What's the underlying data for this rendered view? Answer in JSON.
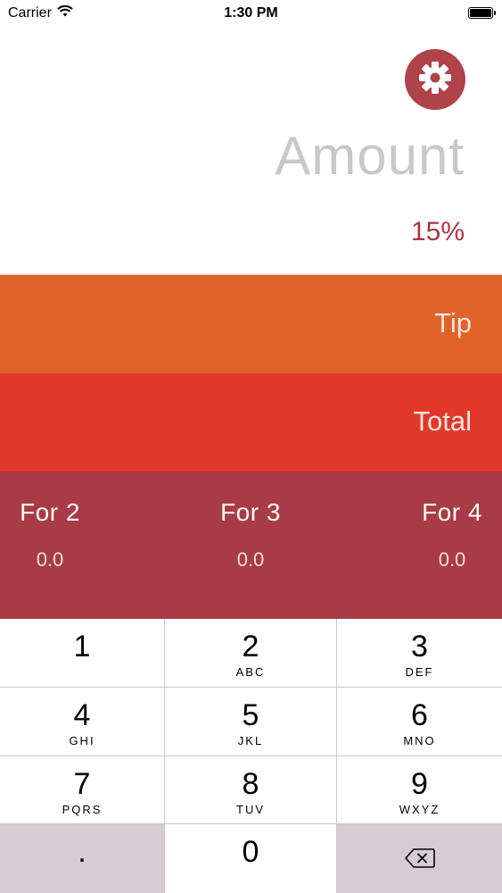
{
  "status_bar": {
    "carrier": "Carrier",
    "time": "1:30 PM",
    "battery_level": 1.0
  },
  "header": {
    "settings_icon": "gear-icon",
    "amount_placeholder": "Amount",
    "tip_percent": "15%"
  },
  "bands": {
    "tip_label": "Tip",
    "total_label": "Total"
  },
  "split": [
    {
      "label": "For 2",
      "value": "0.0"
    },
    {
      "label": "For 3",
      "value": "0.0"
    },
    {
      "label": "For 4",
      "value": "0.0"
    }
  ],
  "keypad": {
    "keys": [
      {
        "num": "1",
        "letters": ""
      },
      {
        "num": "2",
        "letters": "ABC"
      },
      {
        "num": "3",
        "letters": "DEF"
      },
      {
        "num": "4",
        "letters": "GHI"
      },
      {
        "num": "5",
        "letters": "JKL"
      },
      {
        "num": "6",
        "letters": "MNO"
      },
      {
        "num": "7",
        "letters": "PQRS"
      },
      {
        "num": "8",
        "letters": "TUV"
      },
      {
        "num": "9",
        "letters": "WXYZ"
      },
      {
        "num": ".",
        "letters": ""
      },
      {
        "num": "0",
        "letters": ""
      },
      {
        "num": "",
        "letters": "",
        "icon": "backspace-icon"
      }
    ]
  },
  "colors": {
    "accent": "#b0424a",
    "tip_band": "#df6329",
    "total_band": "#e2382c",
    "split_band": "#a83b44"
  }
}
